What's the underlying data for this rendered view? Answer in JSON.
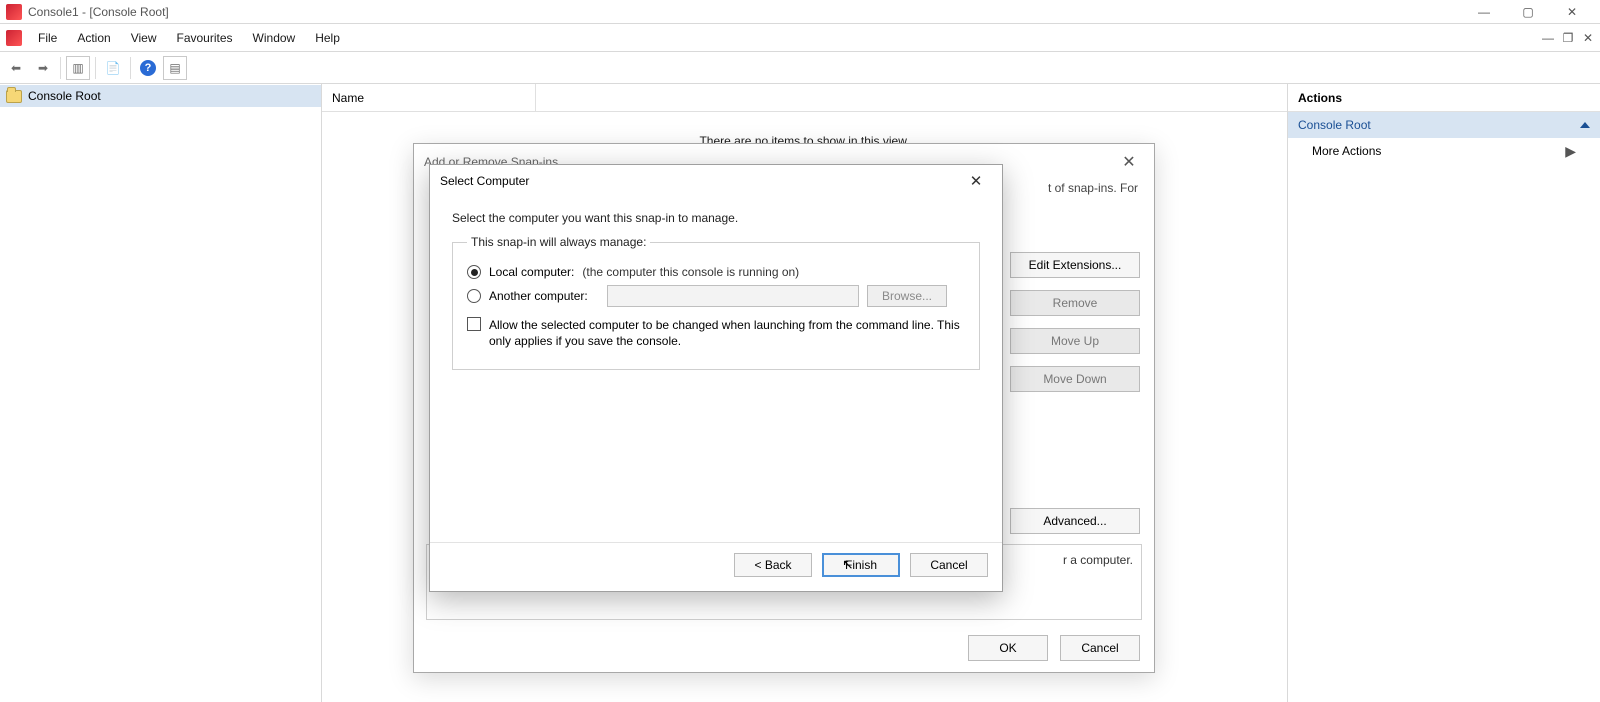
{
  "window": {
    "title": "Console1 - [Console Root]"
  },
  "menu": {
    "file": "File",
    "action": "Action",
    "view": "View",
    "favourites": "Favourites",
    "window": "Window",
    "help": "Help"
  },
  "tree": {
    "root": "Console Root"
  },
  "list": {
    "col_name": "Name",
    "empty": "There are no items to show in this view."
  },
  "actions": {
    "title": "Actions",
    "group": "Console Root",
    "more": "More Actions"
  },
  "snapins_dialog": {
    "title": "Add or Remove Snap-ins",
    "blurb_fragment": "t of snap-ins. For",
    "edit_extensions": "Edit Extensions...",
    "remove": "Remove",
    "move_up": "Move Up",
    "move_down": "Move Down",
    "advanced": "Advanced...",
    "desc_fragment": "r a computer.",
    "ok": "OK",
    "cancel": "Cancel"
  },
  "select_dialog": {
    "title": "Select Computer",
    "instruction": "Select the computer you want this snap-in to manage.",
    "legend": "This snap-in will always manage:",
    "local_label": "Local computer:",
    "local_hint": "(the computer this console is running on)",
    "another_label": "Another computer:",
    "browse": "Browse...",
    "allow_change": "Allow the selected computer to be changed when launching from the command line.  This only applies if you save the console.",
    "back": "< Back",
    "finish": "Finish",
    "cancel": "Cancel"
  }
}
